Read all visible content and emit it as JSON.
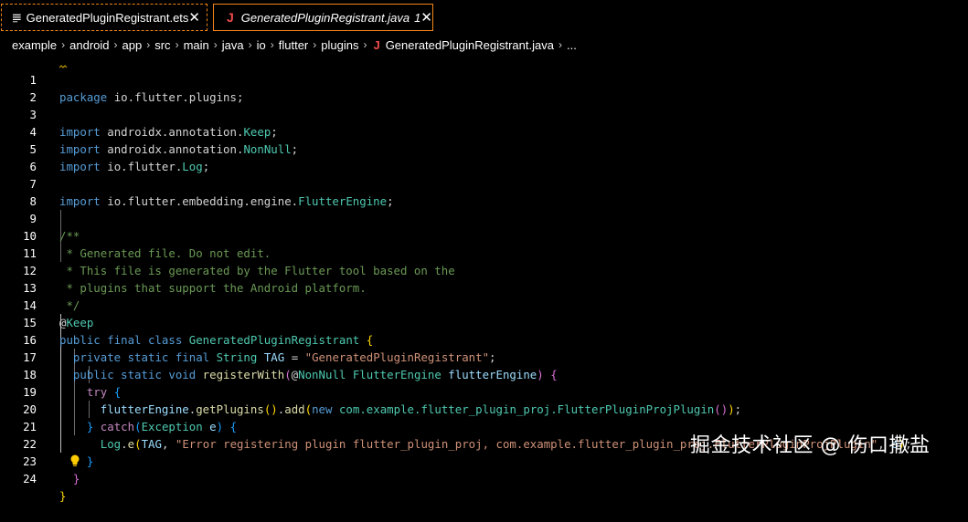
{
  "tabs": [
    {
      "label": "GeneratedPluginRegistrant.ets",
      "icon": "text-lines-icon",
      "close": "✕"
    },
    {
      "label": "GeneratedPluginRegistrant.java",
      "icon": "java-icon",
      "icon_glyph": "J",
      "problem_count": "1",
      "close": "✕"
    }
  ],
  "breadcrumb": {
    "items": [
      "example",
      "android",
      "app",
      "src",
      "main",
      "java",
      "io",
      "flutter",
      "plugins"
    ],
    "file_icon": "J",
    "file": "GeneratedPluginRegistrant.java",
    "more": "..."
  },
  "editor": {
    "line_numbers": [
      "1",
      "2",
      "3",
      "4",
      "5",
      "6",
      "7",
      "8",
      "9",
      "10",
      "11",
      "12",
      "13",
      "14",
      "15",
      "16",
      "17",
      "18",
      "19",
      "20",
      "21",
      "22",
      "23",
      "24"
    ],
    "tokens": {
      "package_kw": "package",
      "package_name": "io.flutter.plugins",
      "semi": ";",
      "import_kw": "import",
      "imp1_pkg": "androidx.annotation.",
      "imp1_cls": "Keep",
      "imp2_pkg": "androidx.annotation.",
      "imp2_cls": "NonNull",
      "imp3_pkg": "io.flutter.",
      "imp3_cls": "Log",
      "imp4_pkg": "io.flutter.embedding.engine.",
      "imp4_cls": "FlutterEngine",
      "c9": "/**",
      "c10": " * Generated file. Do not edit.",
      "c11": " * This file is generated by the Flutter tool based on the",
      "c12": " * plugins that support the Android platform.",
      "c13": " */",
      "at": "@",
      "keep": "Keep",
      "public_final_class": "public final class",
      "class_name": "GeneratedPluginRegistrant",
      "open_brace": "{",
      "close_brace": "}",
      "private_static_final": "private static final",
      "string_type": "String",
      "tag_var": "TAG",
      "equals": "=",
      "tag_value": "\"GeneratedPluginRegistrant\"",
      "public_static_void": "public static void",
      "register_with": "registerWith",
      "paren_open": "(",
      "paren_close": ")",
      "nonnull": "NonNull",
      "flutter_engine_type": "FlutterEngine",
      "flutter_engine_var": "flutterEngine",
      "try_kw": "try",
      "get_plugins": "getPlugins",
      "dot": ".",
      "add": "add",
      "new_kw": "new",
      "plugin_pkg": "com.example.flutter_plugin_proj.",
      "plugin_cls": "FlutterPluginProjPlugin",
      "catch_kw": "catch",
      "exception_type": "Exception",
      "e_var": "e",
      "log_cls": "Log",
      "e_method": "e",
      "comma": ",",
      "error_msg": "\"Error registering plugin flutter_plugin_proj, com.example.flutter_plugin_proj.FlutterPluginProjPlugin\""
    }
  },
  "watermark": "掘金技术社区 @ 伤口撒盐",
  "colors": {
    "background": "#000000",
    "keyword": "#569cd6",
    "control": "#c586c0",
    "type": "#4ec9b0",
    "string": "#ce9178",
    "comment": "#6a9955",
    "function": "#dcdcaa",
    "variable": "#9cdcfe",
    "tab_border": "#f38518",
    "java_icon": "#f14c4c"
  }
}
